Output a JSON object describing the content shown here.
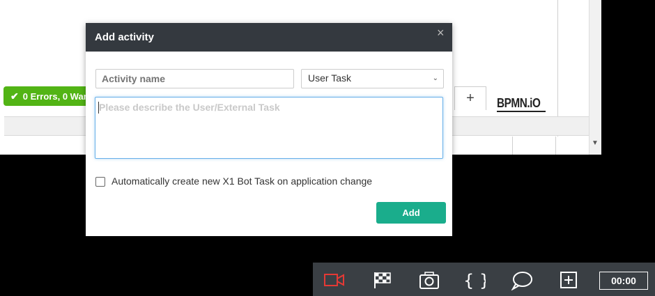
{
  "background": {
    "status_text": "0 Errors, 0 Warnings",
    "tab_add_label": "+",
    "logo_text": "BPMN.iO"
  },
  "modal": {
    "title": "Add activity",
    "close_label": "×",
    "name_placeholder": "Activity name",
    "type_selected": "User Task",
    "description_placeholder": "Please describe the User/External Task",
    "auto_create_label": "Automatically create new X1 Bot Task on application change",
    "auto_create_checked": false,
    "add_label": "Add"
  },
  "toolbar": {
    "icons": [
      "video-camera-icon",
      "checkered-flag-icon",
      "camera-icon",
      "braces-icon",
      "speech-bubble-icon",
      "plus-square-icon"
    ],
    "timer": "00:00",
    "record_color": "#e53935"
  }
}
